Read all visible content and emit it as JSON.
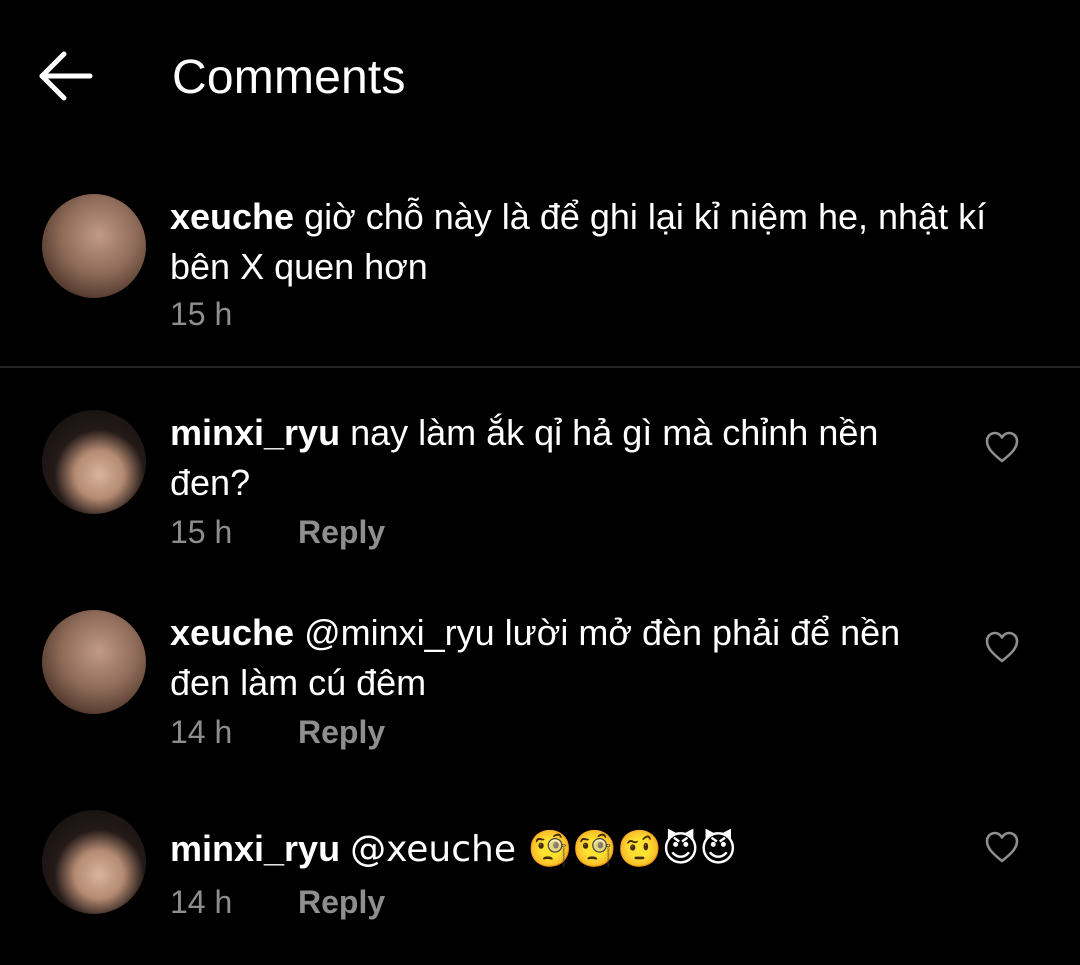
{
  "header": {
    "title": "Comments",
    "back_icon": "arrow-left-icon"
  },
  "comments": [
    {
      "username": "xeuche",
      "text": "giờ chỗ này là để ghi lại kỉ niệm he, nhật kí bên X quen hơn",
      "time": "15 h",
      "is_caption": true
    },
    {
      "username": "minxi_ryu",
      "text": "nay làm ắk qỉ hả gì mà chỉnh nền đen?",
      "time": "15 h",
      "reply_label": "Reply",
      "like_icon": "heart-outline-icon"
    },
    {
      "username": "xeuche",
      "text": "@minxi_ryu lười mở đèn phải để nền đen làm cú đêm",
      "time": "14 h",
      "reply_label": "Reply",
      "like_icon": "heart-outline-icon"
    },
    {
      "username": "minxi_ryu",
      "text": "@xeuche 🧐🧐🤨😈😈",
      "time": "14 h",
      "reply_label": "Reply",
      "like_icon": "heart-outline-icon"
    }
  ],
  "colors": {
    "background": "#000000",
    "text": "#ffffff",
    "secondary_text": "#8e8e8e",
    "divider": "#262626"
  }
}
